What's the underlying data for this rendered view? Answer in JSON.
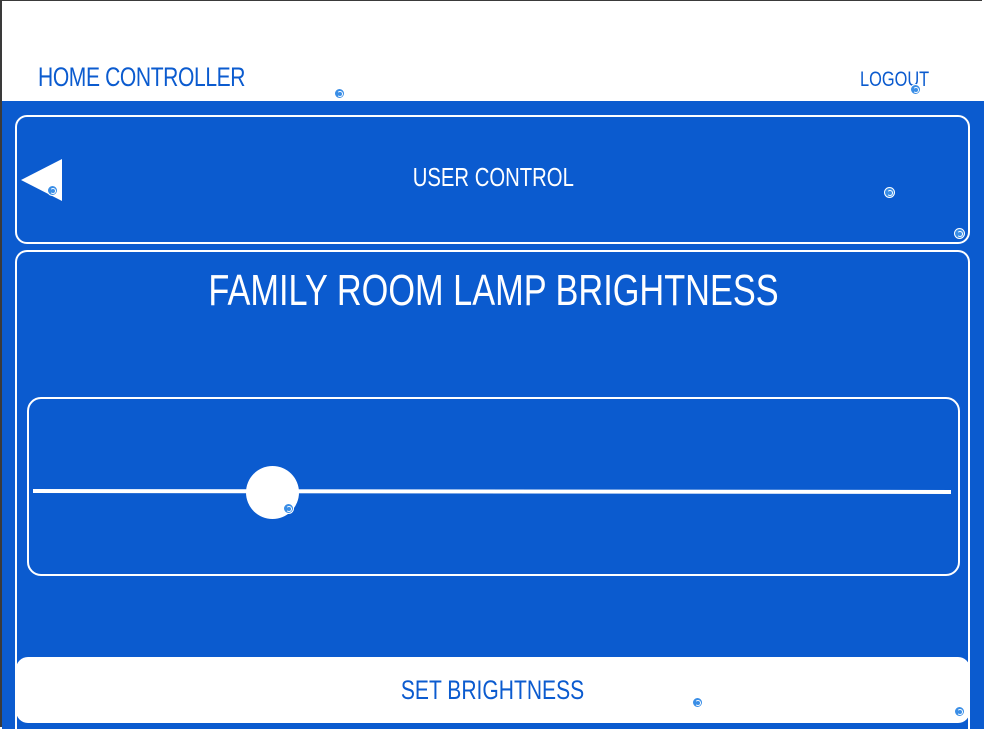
{
  "header": {
    "app_title": "HOME CONTROLLER",
    "logout_label": "LOGOUT"
  },
  "nav": {
    "back_icon": "back-triangle-icon",
    "title": "USER CONTROL"
  },
  "panel": {
    "title": "FAMILY ROOM LAMP BRIGHTNESS",
    "brightness_fraction": 0.26,
    "set_button_label": "SET BRIGHTNESS"
  },
  "colors": {
    "accent": "#0b5bcf",
    "foreground": "#ffffff",
    "hotspot": "#3a8ee6"
  },
  "icons": {
    "hotspot_marker": "refresh-hotspot-icon"
  }
}
